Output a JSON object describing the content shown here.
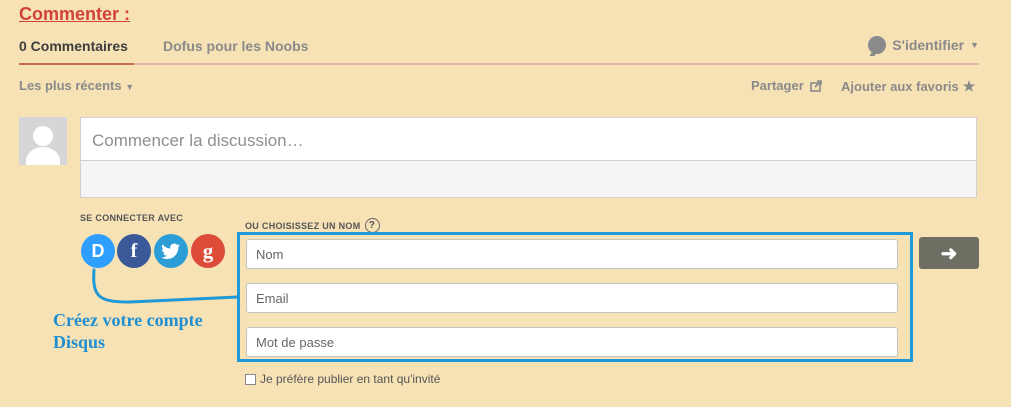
{
  "section": {
    "title": "Commenter :"
  },
  "tabs": {
    "comments": "0 Commentaires",
    "forum": "Dofus pour les Noobs"
  },
  "login": {
    "label": "S'identifier",
    "icon": "disqus-bubble-icon"
  },
  "sort": {
    "label": "Les plus récents"
  },
  "actions": {
    "share": "Partager",
    "favorite": "Ajouter aux favoris"
  },
  "comment": {
    "placeholder": "Commencer la discussion…"
  },
  "connect": {
    "label": "SE CONNECTER AVEC",
    "services": [
      {
        "name": "Disqus",
        "glyph": "D",
        "color": "#2e9fff"
      },
      {
        "name": "Facebook",
        "glyph": "f",
        "color": "#3b5998"
      },
      {
        "name": "Twitter",
        "glyph": "t",
        "color": "#2c9dd6"
      },
      {
        "name": "Google",
        "glyph": "g",
        "color": "#dd4b39"
      }
    ]
  },
  "guest_form": {
    "label": "OU CHOISISSEZ UN NOM",
    "help": "?",
    "name_placeholder": "Nom",
    "email_placeholder": "Email",
    "password_placeholder": "Mot de passe",
    "guest_checkbox": "Je préfère publier en tant qu'invité",
    "submit_glyph": "➜"
  },
  "annotation": {
    "callout": "Créez votre compte Disqus",
    "color": "#1f8fd1"
  },
  "colors": {
    "background": "#f7e2b6",
    "accent": "#d0413a",
    "frame": "#1f9ad8"
  }
}
